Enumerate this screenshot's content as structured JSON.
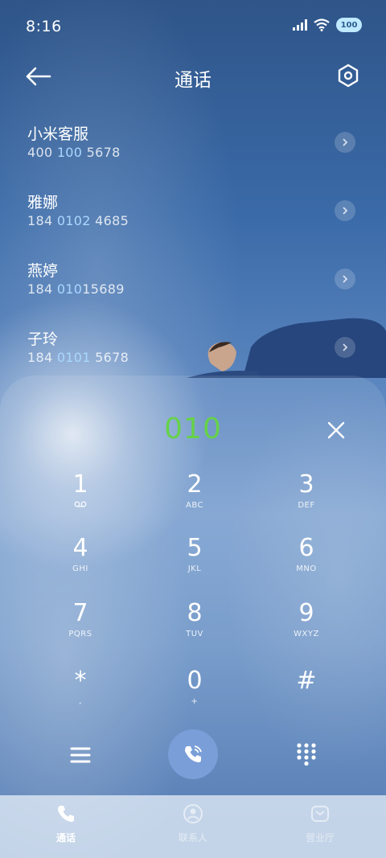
{
  "status_bar": {
    "time": "8:16",
    "battery": "100",
    "icons": [
      "signal-icon",
      "wifi-icon",
      "battery-icon"
    ]
  },
  "header": {
    "title": "通话",
    "back_icon": "back-arrow-icon",
    "settings_icon": "settings-hexagon-icon"
  },
  "contacts": [
    {
      "name": "小米客服",
      "number_parts": [
        "400 ",
        "100",
        " 5678"
      ]
    },
    {
      "name": "雅娜",
      "number_parts": [
        "184 ",
        "0102",
        " 4685"
      ]
    },
    {
      "name": "燕婷",
      "number_parts": [
        "184 ",
        "010",
        "15689"
      ]
    },
    {
      "name": "子玲",
      "number_parts": [
        "184 ",
        "0101",
        " 5678"
      ]
    }
  ],
  "dialer": {
    "dialed_number": "010",
    "keys": [
      {
        "digit": "1",
        "letters": "voicemail"
      },
      {
        "digit": "2",
        "letters": "ABC"
      },
      {
        "digit": "3",
        "letters": "DEF"
      },
      {
        "digit": "4",
        "letters": "GHI"
      },
      {
        "digit": "5",
        "letters": "JKL"
      },
      {
        "digit": "6",
        "letters": "MNO"
      },
      {
        "digit": "7",
        "letters": "PQRS"
      },
      {
        "digit": "8",
        "letters": "TUV"
      },
      {
        "digit": "9",
        "letters": "WXYZ"
      },
      {
        "digit": "*",
        "letters": ","
      },
      {
        "digit": "0",
        "letters": "+"
      },
      {
        "digit": "#",
        "letters": ""
      }
    ]
  },
  "bottom_nav": [
    {
      "label": "通话",
      "icon": "phone-icon",
      "active": true
    },
    {
      "label": "联系人",
      "icon": "contacts-icon",
      "active": false
    },
    {
      "label": "营业厅",
      "icon": "service-hall-icon",
      "active": false
    }
  ],
  "colors": {
    "dialed_number": "#66d24a",
    "number_highlight": "#a9d8ff",
    "call_button": "#7a9ed8"
  }
}
